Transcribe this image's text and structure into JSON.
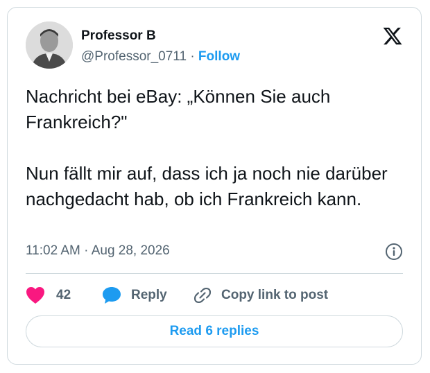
{
  "author": {
    "name": "Professor B",
    "handle": "@Professor_0711",
    "separator": "·",
    "follow_label": "Follow"
  },
  "post": {
    "paragraphs": [
      "Nachricht bei eBay: „Können Sie auch Frankreich?\"",
      "Nun fällt mir auf, dass ich ja noch nie darüber nachgedacht hab, ob ich Frankreich kann."
    ],
    "timestamp": "11:02 AM · Aug 28, 2026"
  },
  "actions": {
    "like_count": "42",
    "reply_label": "Reply",
    "copy_label": "Copy link to post"
  },
  "read_replies_label": "Read 6 replies",
  "colors": {
    "accent": "#1d9bf0",
    "like": "#f91880",
    "muted": "#536471",
    "border": "#cfd9de"
  },
  "icons": {
    "brand": "x-logo-icon",
    "info": "info-icon",
    "like": "heart-icon",
    "reply": "speech-bubble-icon",
    "copy": "link-icon"
  }
}
